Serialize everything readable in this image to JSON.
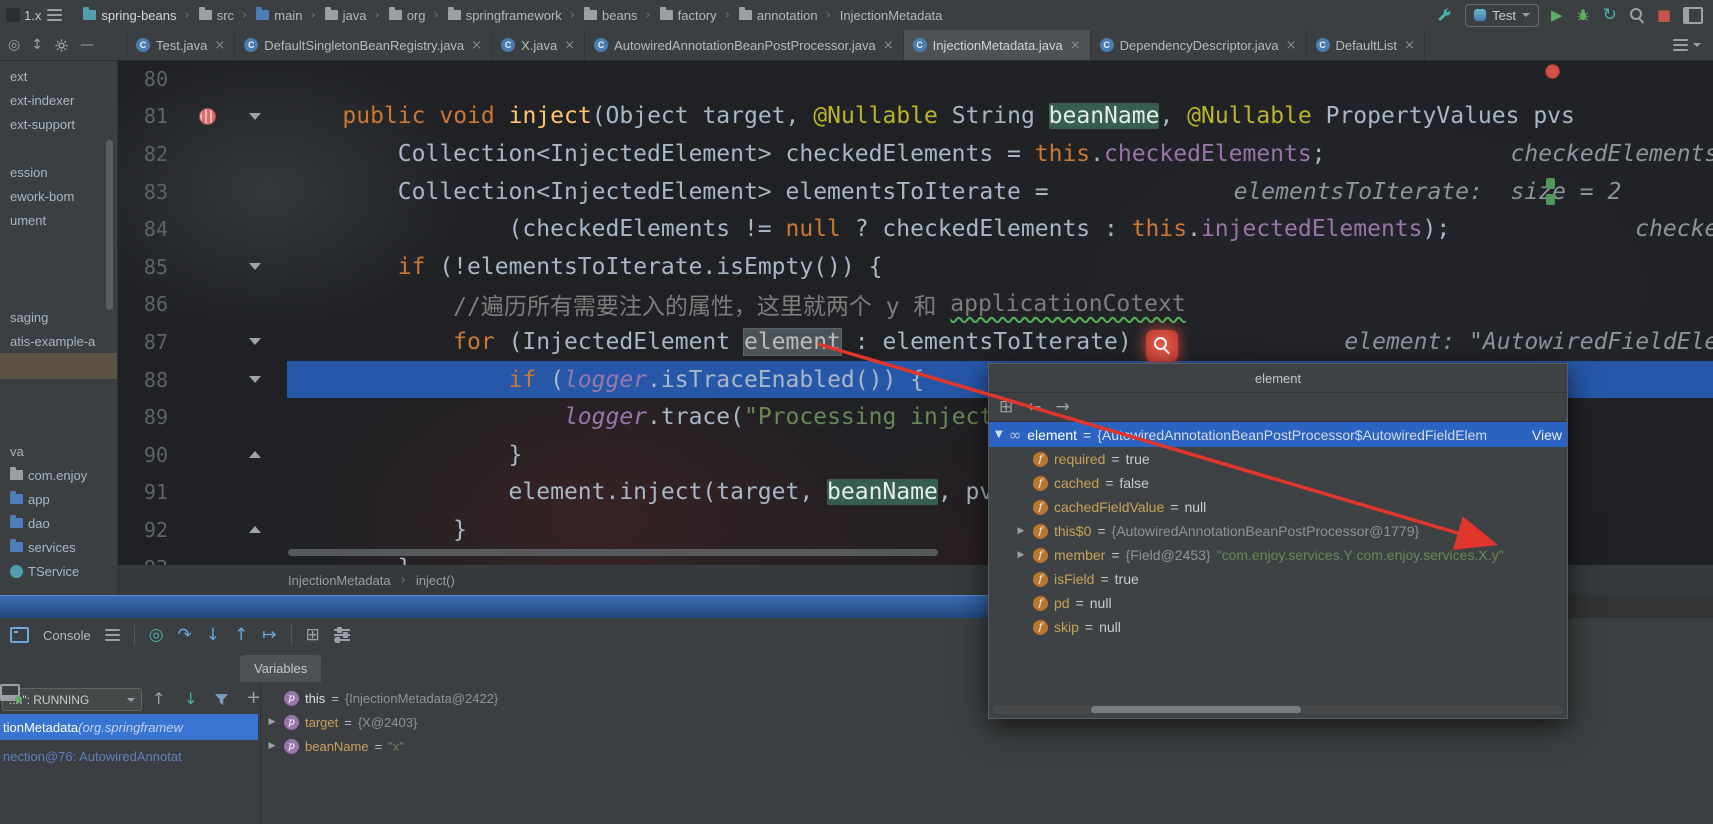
{
  "ui": {
    "eq": " = "
  },
  "icons": {
    "close": "×",
    "class_letter": "C",
    "chevron": "›",
    "expand": "▶",
    "collapse": "▼",
    "infinity": "∞",
    "field_letter": "f",
    "param_letter": "p",
    "play": "▶",
    "stop": "■",
    "restart_debug": "↻",
    "step_show_exec": "◎",
    "step_over": "↷",
    "step_into": "↓",
    "step_out": "↑",
    "run_to_cursor": "↦",
    "grid": "⊞",
    "eval": "⊞",
    "back": "←",
    "forward": "→",
    "up": "↑",
    "down": "↓",
    "plus": "+",
    "locate": "◎",
    "updown": "↕",
    "minus": "—"
  },
  "topbar": {
    "branch": "1.x",
    "run_config": "Test",
    "breadcrumbs": [
      {
        "label": "spring-beans",
        "icls": "teal",
        "sep": "",
        "cls": "first"
      },
      {
        "label": "src",
        "icls": "gray",
        "sep": "›",
        "cls": ""
      },
      {
        "label": "main",
        "icls": "blue",
        "sep": "›",
        "cls": ""
      },
      {
        "label": "java",
        "icls": "gray",
        "sep": "›",
        "cls": ""
      },
      {
        "label": "org",
        "icls": "gray",
        "sep": "›",
        "cls": ""
      },
      {
        "label": "springframework",
        "icls": "gray",
        "sep": "›",
        "cls": ""
      },
      {
        "label": "beans",
        "icls": "gray",
        "sep": "›",
        "cls": ""
      },
      {
        "label": "factory",
        "icls": "gray",
        "sep": "›",
        "cls": ""
      },
      {
        "label": "annotation",
        "icls": "gray",
        "sep": "›",
        "cls": ""
      },
      {
        "label": "InjectionMetadata",
        "icls": "none",
        "sep": "›",
        "cls": ""
      }
    ]
  },
  "tabs": [
    {
      "label": "Test.java",
      "cls": ""
    },
    {
      "label": "DefaultSingletonBeanRegistry.java",
      "cls": ""
    },
    {
      "label": "X.java",
      "cls": ""
    },
    {
      "label": "AutowiredAnnotationBeanPostProcessor.java",
      "cls": ""
    },
    {
      "label": "InjectionMetadata.java",
      "cls": "active"
    },
    {
      "label": "DependencyDescriptor.java",
      "cls": ""
    },
    {
      "label": "DefaultList",
      "cls": ""
    }
  ],
  "project": {
    "items": [
      {
        "label": "ext",
        "cls": "",
        "icon": "none"
      },
      {
        "label": "ext-indexer",
        "cls": "",
        "icon": "none"
      },
      {
        "label": "ext-support",
        "cls": "",
        "icon": "none"
      },
      {
        "label": "ession",
        "cls": "g1",
        "icon": "none"
      },
      {
        "label": "ework-bom",
        "cls": "",
        "icon": "none"
      },
      {
        "label": "ument",
        "cls": "",
        "icon": "none"
      },
      {
        "label": "saging",
        "cls": "g2",
        "icon": "none"
      },
      {
        "label": "atis-example-a",
        "cls": "",
        "icon": "none"
      },
      {
        "label": "",
        "cls": "selrow",
        "icon": "none"
      },
      {
        "label": "va",
        "cls": "g3",
        "icon": "none"
      },
      {
        "label": "com.enjoy",
        "cls": "",
        "icon": "fgray"
      },
      {
        "label": "app",
        "cls": "",
        "icon": "fblue"
      },
      {
        "label": "dao",
        "cls": "",
        "icon": "fblue"
      },
      {
        "label": "services",
        "cls": "",
        "icon": "fblue"
      },
      {
        "label": "TService",
        "cls": "",
        "icon": "cls"
      }
    ]
  },
  "editor": {
    "breadcrumb": {
      "file": "InjectionMetadata",
      "method": "inject()"
    },
    "lines": [
      {
        "num": "80",
        "cls": "",
        "bp": "",
        "fold": "",
        "segments": []
      },
      {
        "num": "81",
        "cls": "",
        "bp": "on",
        "fold": "down",
        "segments": [
          {
            "t": "    ",
            "c": "p"
          },
          {
            "t": "public",
            "c": "k"
          },
          {
            "t": " ",
            "c": "p"
          },
          {
            "t": "void",
            "c": "k"
          },
          {
            "t": " ",
            "c": "p"
          },
          {
            "t": "inject",
            "c": "m"
          },
          {
            "t": "(Object target, ",
            "c": "p"
          },
          {
            "t": "@Nullable",
            "c": "a"
          },
          {
            "t": " String ",
            "c": "p"
          },
          {
            "t": "beanName",
            "c": "selg"
          },
          {
            "t": ", ",
            "c": "p"
          },
          {
            "t": "@Nullable",
            "c": "a"
          },
          {
            "t": " PropertyValues pvs",
            "c": "p"
          }
        ]
      },
      {
        "num": "82",
        "cls": "",
        "bp": "",
        "fold": "",
        "segments": [
          {
            "t": "        Collection<InjectedElement> checkedElements = ",
            "c": "p"
          },
          {
            "t": "this",
            "c": "k"
          },
          {
            "t": ".",
            "c": "p"
          },
          {
            "t": "checkedElements",
            "c": "f"
          },
          {
            "t": ";",
            "c": "p"
          },
          {
            "t": "checkedElements:",
            "c": "h"
          }
        ]
      },
      {
        "num": "83",
        "cls": "",
        "bp": "",
        "fold": "",
        "segments": [
          {
            "t": "        Collection<InjectedElement> elementsToIterate =",
            "c": "p"
          },
          {
            "t": "elementsToIterate:  size = 2",
            "c": "h"
          }
        ]
      },
      {
        "num": "84",
        "cls": "",
        "bp": "",
        "fold": "",
        "segments": [
          {
            "t": "                (checkedElements != ",
            "c": "p"
          },
          {
            "t": "null",
            "c": "k"
          },
          {
            "t": " ? checkedElements : ",
            "c": "p"
          },
          {
            "t": "this",
            "c": "k"
          },
          {
            "t": ".",
            "c": "p"
          },
          {
            "t": "injectedElements",
            "c": "f"
          },
          {
            "t": ");",
            "c": "p"
          },
          {
            "t": "checked",
            "c": "h"
          }
        ]
      },
      {
        "num": "85",
        "cls": "",
        "bp": "",
        "fold": "down",
        "segments": [
          {
            "t": "        ",
            "c": "p"
          },
          {
            "t": "if",
            "c": "k"
          },
          {
            "t": " (!elementsToIterate.isEmpty()) {",
            "c": "p"
          }
        ]
      },
      {
        "num": "86",
        "cls": "",
        "bp": "",
        "fold": "",
        "segments": [
          {
            "t": "            ",
            "c": "p"
          },
          {
            "t": "//遍历所有需要注入的属性，这里就两个 y 和 ",
            "c": "c"
          },
          {
            "t": "applicationCotext",
            "c": "ct"
          }
        ]
      },
      {
        "num": "87",
        "cls": "",
        "bp": "",
        "fold": "down",
        "segments": [
          {
            "t": "            ",
            "c": "p"
          },
          {
            "t": "for",
            "c": "k"
          },
          {
            "t": " (InjectedElement ",
            "c": "p"
          },
          {
            "t": "element",
            "c": "selw"
          },
          {
            "t": " : elementsToIterate) {",
            "c": "p"
          },
          {
            "t": "element: \"AutowiredFieldElem",
            "c": "h"
          }
        ]
      },
      {
        "num": "88",
        "cls": "exec",
        "bp": "",
        "fold": "down",
        "segments": [
          {
            "t": "                ",
            "c": "p"
          },
          {
            "t": "if",
            "c": "k"
          },
          {
            "t": " (",
            "c": "p"
          },
          {
            "t": "logger",
            "c": "fi"
          },
          {
            "t": ".isTraceEnabled()) {",
            "c": "p"
          }
        ]
      },
      {
        "num": "89",
        "cls": "",
        "bp": "",
        "fold": "",
        "segments": [
          {
            "t": "                    ",
            "c": "p"
          },
          {
            "t": "logger",
            "c": "fi"
          },
          {
            "t": ".trace(",
            "c": "p"
          },
          {
            "t": "\"Processing inject",
            "c": "s"
          }
        ]
      },
      {
        "num": "90",
        "cls": "",
        "bp": "",
        "fold": "up",
        "segments": [
          {
            "t": "                }",
            "c": "p"
          }
        ]
      },
      {
        "num": "91",
        "cls": "",
        "bp": "",
        "fold": "",
        "segments": [
          {
            "t": "                element.inject(target, ",
            "c": "p"
          },
          {
            "t": "beanName",
            "c": "selg"
          },
          {
            "t": ", pv",
            "c": "p"
          }
        ]
      },
      {
        "num": "92",
        "cls": "",
        "bp": "",
        "fold": "up",
        "segments": [
          {
            "t": "            }",
            "c": "p"
          }
        ]
      },
      {
        "num": "93",
        "cls": "",
        "bp": "",
        "fold": "",
        "segments": [
          {
            "t": "        }",
            "c": "p"
          }
        ]
      }
    ]
  },
  "popup": {
    "title": "element",
    "selected": {
      "name": "element",
      "value": "{AutowiredAnnotationBeanPostProcessor$AutowiredFieldElem",
      "link": "View"
    },
    "rows": [
      {
        "arrow": "hid",
        "name": "required",
        "val": "true",
        "valcls": "vplain",
        "str": ""
      },
      {
        "arrow": "hid",
        "name": "cached",
        "val": "false",
        "valcls": "vplain",
        "str": ""
      },
      {
        "arrow": "hid",
        "name": "cachedFieldValue",
        "val": "null",
        "valcls": "vplain",
        "str": ""
      },
      {
        "arrow": "vis",
        "name": "this$0",
        "val": "{AutowiredAnnotationBeanPostProcessor@1779}",
        "valcls": "vref",
        "str": ""
      },
      {
        "arrow": "vis",
        "name": "member",
        "val": "{Field@2453} ",
        "valcls": "vref",
        "str": "\"com.enjoy.services.Y com.enjoy.services.X.y\""
      },
      {
        "arrow": "hid",
        "name": "isField",
        "val": "true",
        "valcls": "vplain",
        "str": ""
      },
      {
        "arrow": "hid",
        "name": "pd",
        "val": "null",
        "valcls": "vplain",
        "str": ""
      },
      {
        "arrow": "hid",
        "name": "skip",
        "val": "null",
        "valcls": "vplain",
        "str": ""
      }
    ]
  },
  "debug": {
    "console_label": "Console",
    "variables_label": "Variables",
    "threads": "..n\": RUNNING",
    "frames": {
      "sel_main": "tionMetadata ",
      "sel_pkg": "(org.springframew",
      "second": "nection@76: AutowiredAnnotat"
    },
    "variables": [
      {
        "arrow": "hid",
        "ncls": "white",
        "name": "this",
        "val": "{InjectionMetadata@2422}",
        "valcls": "vref"
      },
      {
        "arrow": "vis",
        "ncls": "gold",
        "name": "target",
        "val": "{X@2403}",
        "valcls": "vref"
      },
      {
        "arrow": "vis",
        "ncls": "gold",
        "name": "beanName",
        "val": "\"x\"",
        "valcls": "vstr"
      }
    ]
  }
}
